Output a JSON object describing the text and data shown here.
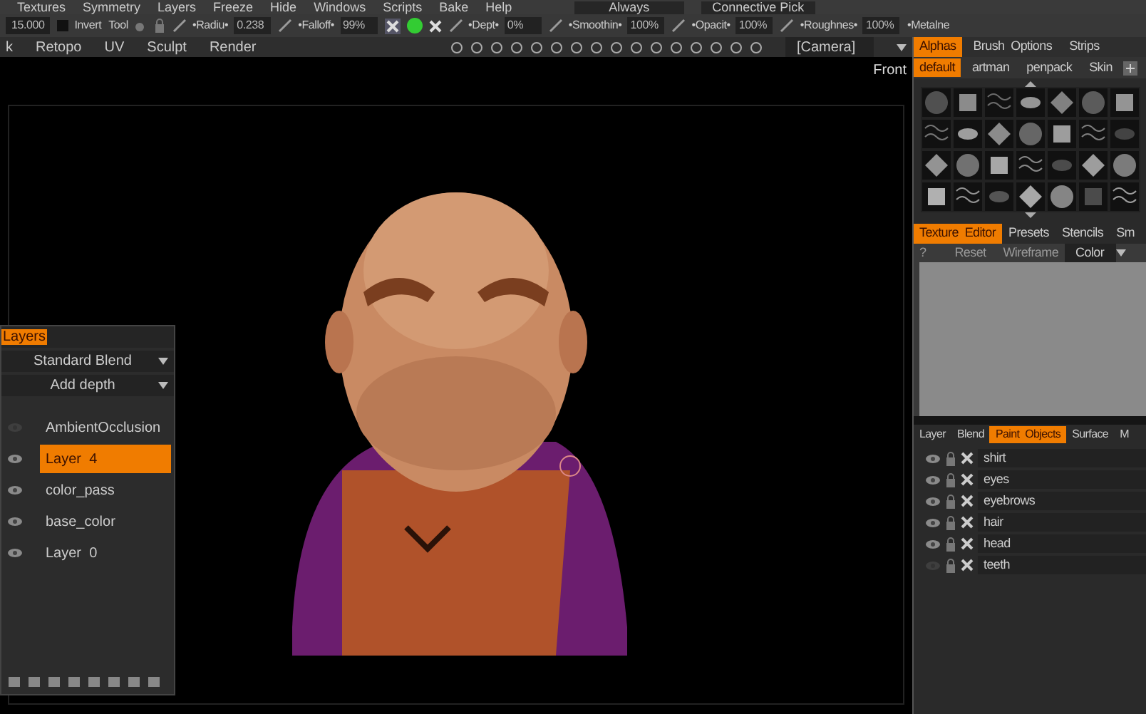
{
  "menu": [
    "Textures",
    "Symmetry",
    "Layers",
    "Freeze",
    "Hide",
    "Windows",
    "Scripts",
    "Bake",
    "Help"
  ],
  "menu_right": {
    "dropdown_1": "Always",
    "dropdown_2": "Connective Pick"
  },
  "toolbar": [
    {
      "kind": "field",
      "value": "15.000"
    },
    {
      "kind": "check",
      "label": "Invert",
      "checked": false
    },
    {
      "kind": "label",
      "label": "Tool"
    },
    {
      "kind": "param",
      "label": "•Radiu•",
      "value": "0.238"
    },
    {
      "kind": "param",
      "label": "•Falloff•",
      "value": "99%"
    },
    {
      "kind": "icons"
    },
    {
      "kind": "param",
      "label": "•Dept•",
      "value": "0%"
    },
    {
      "kind": "param",
      "label": "•Smoothin•",
      "value": "100%"
    },
    {
      "kind": "param",
      "label": "•Opacit•",
      "value": "100%"
    },
    {
      "kind": "param",
      "label": "•Roughnes•",
      "value": "100%"
    },
    {
      "kind": "label",
      "label": "•Metalne"
    }
  ],
  "rooms": [
    "k",
    "Retopo",
    "UV",
    "Sculpt",
    "Render"
  ],
  "camera": "[Camera]",
  "viewport": {
    "view_label": "Front"
  },
  "layers_panel": {
    "title": "Layers",
    "blend": "Standard Blend",
    "depth": "Add depth",
    "layers": [
      {
        "name": "AmbientOcclusion",
        "visible": false,
        "selected": false
      },
      {
        "name": "Layer  4",
        "visible": true,
        "selected": true
      },
      {
        "name": "color_pass",
        "visible": true,
        "selected": false
      },
      {
        "name": "base_color",
        "visible": true,
        "selected": false
      },
      {
        "name": "Layer  0",
        "visible": true,
        "selected": false
      }
    ]
  },
  "alphas_tabs": [
    {
      "label": "Alphas",
      "selected": true
    },
    {
      "label": "Brush  Options",
      "selected": false
    },
    {
      "label": "Strips",
      "selected": false
    }
  ],
  "alpha_sets": [
    {
      "label": "default",
      "selected": true
    },
    {
      "label": "artman",
      "selected": false
    },
    {
      "label": "penpack",
      "selected": false
    },
    {
      "label": "Skin",
      "selected": false
    }
  ],
  "editor_tabs": [
    {
      "label": "Texture  Editor",
      "selected": true
    },
    {
      "label": "Presets",
      "selected": false
    },
    {
      "label": "Stencils",
      "selected": false
    },
    {
      "label": "Sm",
      "selected": false
    }
  ],
  "editor_toolbar": {
    "help": "?",
    "reset": "Reset",
    "wireframe": "Wireframe",
    "mode": "Color"
  },
  "object_tabs": [
    {
      "label": "Layer",
      "selected": false
    },
    {
      "label": "Blend",
      "selected": false
    },
    {
      "label": "Paint  Objects",
      "selected": true
    },
    {
      "label": "Surface",
      "selected": false
    },
    {
      "label": "M",
      "selected": false
    }
  ],
  "objects": [
    {
      "name": "shirt",
      "visible": true
    },
    {
      "name": "eyes",
      "visible": true
    },
    {
      "name": "eyebrows",
      "visible": true
    },
    {
      "name": "hair",
      "visible": true
    },
    {
      "name": "head",
      "visible": true
    },
    {
      "name": "teeth",
      "visible": false
    }
  ]
}
